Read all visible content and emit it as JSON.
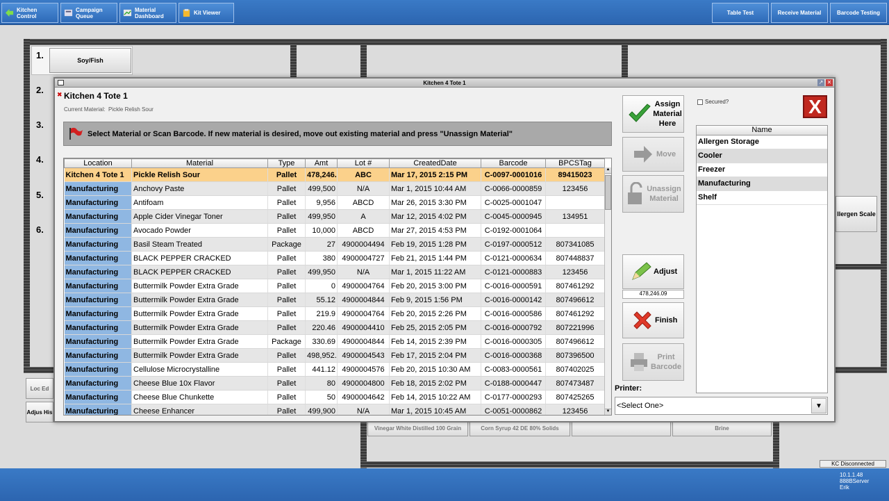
{
  "topbar": {
    "kitchen": "Kitchen Control",
    "campaign": "Campaign Queue",
    "material": "Material Dashboard",
    "kit": "Kit Viewer",
    "table": "Table Test",
    "receive": "Receive Material",
    "barcode": "Barcode Testing"
  },
  "background": {
    "n1": "1.",
    "n2": "2.",
    "n3": "3.",
    "n4": "4.",
    "n5": "5.",
    "n6": "6.",
    "soy": "Soy/Fish",
    "allergen": "llergen Scale",
    "loc": "Loc Ed",
    "adj": "Adjus His",
    "vin": "Vinegar White Distilled 100 Grain",
    "corn": "Corn Syrup 42 DE 80% Solids",
    "brine": "Brine"
  },
  "dialog": {
    "window_title": "Kitchen 4 Tote 1",
    "heading": "Kitchen 4 Tote 1",
    "current_label": "Current Material:",
    "current_value": "Pickle Relish Sour",
    "banner": "Select Material or Scan Barcode. If new material is desired, move out existing material and press \"Unassign Material\"",
    "secured": "Secured?",
    "printer_label": "Printer:",
    "printer_value": "<Select One>",
    "adjust_value": "478,246.09"
  },
  "buttons": {
    "assign": "Assign Material Here",
    "move": "Move",
    "unassign": "Unassign Material",
    "adjust": "Adjust",
    "finish": "Finish",
    "print": "Print Barcode"
  },
  "locations": {
    "header": "Name",
    "items": [
      "Allergen Storage",
      "Cooler",
      "Freezer",
      "Manufacturing",
      "Shelf"
    ]
  },
  "grid": {
    "headers": [
      "Location",
      "Material",
      "Type",
      "Amt",
      "Lot #",
      "CreatedDate",
      "Barcode",
      "BPCSTag"
    ],
    "rows": [
      [
        "Kitchen 4 Tote 1",
        "Pickle Relish Sour",
        "Pallet",
        "478,246.1",
        "ABC",
        "Mar 17, 2015 2:15 PM",
        "C-0097-0001016",
        "89415023"
      ],
      [
        "Manufacturing",
        "Anchovy Paste",
        "Pallet",
        "499,500",
        "N/A",
        "Mar 1, 2015 10:44 AM",
        "C-0066-0000859",
        "123456"
      ],
      [
        "Manufacturing",
        "Antifoam",
        "Pallet",
        "9,956",
        "ABCD",
        "Mar 26, 2015 3:30 PM",
        "C-0025-0001047",
        ""
      ],
      [
        "Manufacturing",
        "Apple Cider Vinegar Toner",
        "Pallet",
        "499,950",
        "A",
        "Mar 12, 2015 4:02 PM",
        "C-0045-0000945",
        "134951"
      ],
      [
        "Manufacturing",
        "Avocado Powder",
        "Pallet",
        "10,000",
        "ABCD",
        "Mar 27, 2015 4:53 PM",
        "C-0192-0001064",
        ""
      ],
      [
        "Manufacturing",
        "Basil Steam Treated",
        "Package",
        "27",
        "4900004494",
        "Feb 19, 2015 1:28 PM",
        "C-0197-0000512",
        "807341085"
      ],
      [
        "Manufacturing",
        "BLACK PEPPER CRACKED",
        "Pallet",
        "380",
        "4900004727",
        "Feb 21, 2015 1:44 PM",
        "C-0121-0000634",
        "807448837"
      ],
      [
        "Manufacturing",
        "BLACK PEPPER CRACKED",
        "Pallet",
        "499,950",
        "N/A",
        "Mar 1, 2015 11:22 AM",
        "C-0121-0000883",
        "123456"
      ],
      [
        "Manufacturing",
        "Buttermilk Powder Extra Grade",
        "Pallet",
        "0",
        "4900004764",
        "Feb 20, 2015 3:00 PM",
        "C-0016-0000591",
        "807461292"
      ],
      [
        "Manufacturing",
        "Buttermilk Powder Extra Grade",
        "Pallet",
        "55.12",
        "4900004844",
        "Feb 9, 2015 1:56 PM",
        "C-0016-0000142",
        "807496612"
      ],
      [
        "Manufacturing",
        "Buttermilk Powder Extra Grade",
        "Pallet",
        "219.9",
        "4900004764",
        "Feb 20, 2015 2:26 PM",
        "C-0016-0000586",
        "807461292"
      ],
      [
        "Manufacturing",
        "Buttermilk Powder Extra Grade",
        "Pallet",
        "220.46",
        "4900004410",
        "Feb 25, 2015 2:05 PM",
        "C-0016-0000792",
        "807221996"
      ],
      [
        "Manufacturing",
        "Buttermilk Powder Extra Grade",
        "Package",
        "330.69",
        "4900004844",
        "Feb 14, 2015 2:39 PM",
        "C-0016-0000305",
        "807496612"
      ],
      [
        "Manufacturing",
        "Buttermilk Powder Extra Grade",
        "Pallet",
        "498,952.8",
        "4900004543",
        "Feb 17, 2015 2:04 PM",
        "C-0016-0000368",
        "807396500"
      ],
      [
        "Manufacturing",
        "Cellulose Microcrystalline",
        "Pallet",
        "441.12",
        "4900004576",
        "Feb 20, 2015 10:30 AM",
        "C-0083-0000561",
        "807402025"
      ],
      [
        "Manufacturing",
        "Cheese Blue 10x Flavor",
        "Pallet",
        "80",
        "4900004800",
        "Feb 18, 2015 2:02 PM",
        "C-0188-0000447",
        "807473487"
      ],
      [
        "Manufacturing",
        "Cheese Blue Chunkette",
        "Pallet",
        "50",
        "4900004642",
        "Feb 14, 2015 10:22 AM",
        "C-0177-0000293",
        "807425265"
      ],
      [
        "Manufacturing",
        "Cheese Enhancer",
        "Pallet",
        "499,900",
        "N/A",
        "Mar 1, 2015 10:45 AM",
        "C-0051-0000862",
        "123456"
      ]
    ]
  },
  "status": {
    "disconnected": "KC Disconnected",
    "ip": "10.1.1.48",
    "server": "888BServer",
    "user": "Erik"
  }
}
